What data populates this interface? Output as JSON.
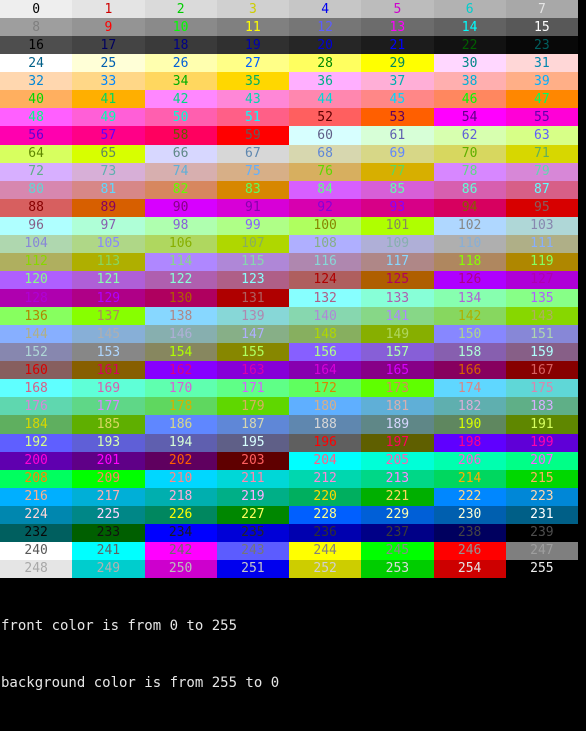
{
  "terminal": {
    "footer_line1": "front color is from 0 to 255",
    "footer_line2": "background color is from 255 to 0"
  },
  "grid": {
    "columns": 8,
    "foreground_start": 0,
    "foreground_end": 255,
    "background_start": 255,
    "background_end": 0
  },
  "palette": [
    "#000000",
    "#cd0000",
    "#00cd00",
    "#cdcd00",
    "#0000ee",
    "#cd00cd",
    "#00cdcd",
    "#e5e5e5",
    "#7f7f7f",
    "#ff0000",
    "#00ff00",
    "#ffff00",
    "#5c5cff",
    "#ff00ff",
    "#00ffff",
    "#ffffff",
    "#000000",
    "#00005f",
    "#000087",
    "#0000af",
    "#0000d7",
    "#0000ff",
    "#005f00",
    "#005f5f",
    "#005f87",
    "#005faf",
    "#005fd7",
    "#005fff",
    "#008700",
    "#00875f",
    "#008787",
    "#0087af",
    "#0087d7",
    "#0087ff",
    "#00af00",
    "#00af5f",
    "#00af87",
    "#00afaf",
    "#00afd7",
    "#00afff",
    "#00d700",
    "#00d75f",
    "#00d787",
    "#00d7af",
    "#00d7d7",
    "#00d7ff",
    "#00ff00",
    "#00ff5f",
    "#00ff87",
    "#00ffaf",
    "#00ffd7",
    "#00ffff",
    "#5f0000",
    "#5f005f",
    "#5f0087",
    "#5f00af",
    "#5f00d7",
    "#5f00ff",
    "#5f5f00",
    "#5f5f5f",
    "#5f5f87",
    "#5f5faf",
    "#5f5fd7",
    "#5f5fff",
    "#5f8700",
    "#5f875f",
    "#5f8787",
    "#5f87af",
    "#5f87d7",
    "#5f87ff",
    "#5faf00",
    "#5faf5f",
    "#5faf87",
    "#5fafaf",
    "#5fafd7",
    "#5fafff",
    "#5fd700",
    "#5fd75f",
    "#5fd787",
    "#5fd7af",
    "#5fd7d7",
    "#5fd7ff",
    "#5fff00",
    "#5fff5f",
    "#5fff87",
    "#5fffaf",
    "#5fffd7",
    "#5fffff",
    "#870000",
    "#87005f",
    "#870087",
    "#8700af",
    "#8700d7",
    "#8700ff",
    "#875f00",
    "#875f5f",
    "#875f87",
    "#875faf",
    "#875fd7",
    "#875fff",
    "#878700",
    "#87875f",
    "#878787",
    "#8787af",
    "#8787d7",
    "#8787ff",
    "#87af00",
    "#87af5f",
    "#87af87",
    "#87afaf",
    "#87afd7",
    "#87afff",
    "#87d700",
    "#87d75f",
    "#87d787",
    "#87d7af",
    "#87d7d7",
    "#87d7ff",
    "#87ff00",
    "#87ff5f",
    "#87ff87",
    "#87ffaf",
    "#87ffd7",
    "#87ffff",
    "#af0000",
    "#af005f",
    "#af0087",
    "#af00af",
    "#af00d7",
    "#af00ff",
    "#af5f00",
    "#af5f5f",
    "#af5f87",
    "#af5faf",
    "#af5fd7",
    "#af5fff",
    "#af8700",
    "#af875f",
    "#af8787",
    "#af87af",
    "#af87d7",
    "#af87ff",
    "#afaf00",
    "#afaf5f",
    "#afaf87",
    "#afafaf",
    "#afafd7",
    "#afafff",
    "#afd700",
    "#afd75f",
    "#afd787",
    "#afd7af",
    "#afd7d7",
    "#afd7ff",
    "#afff00",
    "#afff5f",
    "#afff87",
    "#afffaf",
    "#afffd7",
    "#afffff",
    "#d70000",
    "#d7005f",
    "#d70087",
    "#d700af",
    "#d700d7",
    "#d700ff",
    "#d75f00",
    "#d75f5f",
    "#d75f87",
    "#d75faf",
    "#d75fd7",
    "#d75fff",
    "#d78700",
    "#d7875f",
    "#d78787",
    "#d787af",
    "#d787d7",
    "#d787ff",
    "#d7af00",
    "#d7af5f",
    "#d7af87",
    "#d7afaf",
    "#d7afd7",
    "#d7afff",
    "#d7d700",
    "#d7d75f",
    "#d7d787",
    "#d7d7af",
    "#d7d7d7",
    "#d7d7ff",
    "#d7ff00",
    "#d7ff5f",
    "#d7ff87",
    "#d7ffaf",
    "#d7ffd7",
    "#d7ffff",
    "#ff0000",
    "#ff005f",
    "#ff0087",
    "#ff00af",
    "#ff00d7",
    "#ff00ff",
    "#ff5f00",
    "#ff5f5f",
    "#ff5f87",
    "#ff5faf",
    "#ff5fd7",
    "#ff5fff",
    "#ff8700",
    "#ff875f",
    "#ff8787",
    "#ff87af",
    "#ff87d7",
    "#ff87ff",
    "#ffaf00",
    "#ffaf5f",
    "#ffaf87",
    "#ffafaf",
    "#ffafd7",
    "#ffafff",
    "#ffd700",
    "#ffd75f",
    "#ffd787",
    "#ffd7af",
    "#ffd7d7",
    "#ffd7ff",
    "#ffff00",
    "#ffff5f",
    "#ffff87",
    "#ffffaf",
    "#ffffd7",
    "#ffffff",
    "#080808",
    "#121212",
    "#1c1c1c",
    "#262626",
    "#303030",
    "#3a3a3a",
    "#444444",
    "#4e4e4e",
    "#585858",
    "#626262",
    "#6c6c6c",
    "#767676",
    "#808080",
    "#8a8a8a",
    "#949494",
    "#9e9e9e",
    "#a8a8a8",
    "#b2b2b2",
    "#bcbcbc",
    "#c6c6c6",
    "#d0d0d0",
    "#dadada",
    "#e4e4e4",
    "#eeeeee"
  ]
}
